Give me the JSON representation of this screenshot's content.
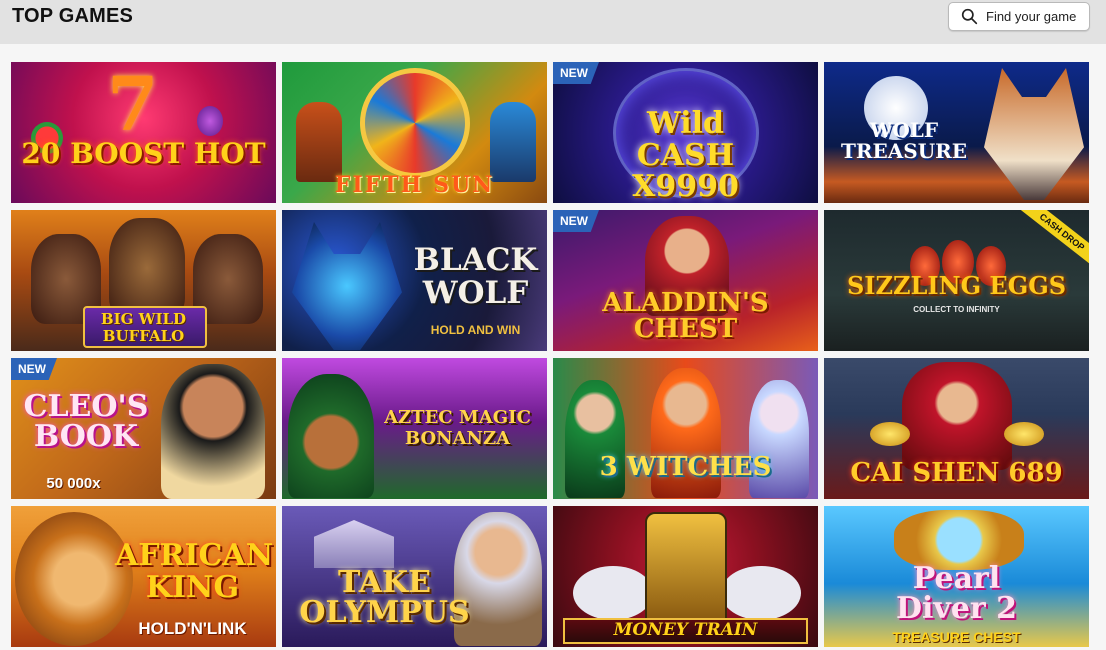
{
  "header": {
    "title": "TOP GAMES",
    "search": {
      "label": "Find your game",
      "icon": "search-icon"
    }
  },
  "badges": {
    "new": "NEW",
    "cash_drop": "CASH DROP"
  },
  "games": [
    {
      "title": "20 BOOST HOT",
      "subtitle": "",
      "badge": "",
      "colors": [
        "#c0114d",
        "#7a0a66"
      ]
    },
    {
      "title": "FIFTH SUN",
      "subtitle": "",
      "badge": "",
      "colors": [
        "#1f8f3c",
        "#d28a10"
      ]
    },
    {
      "title": "Wild CASH X9990",
      "subtitle": "",
      "badge": "NEW",
      "colors": [
        "#1b1b70",
        "#5a2aa8"
      ]
    },
    {
      "title": "WOLF TREASURE",
      "subtitle": "",
      "badge": "",
      "colors": [
        "#0e2a6e",
        "#c65a22"
      ]
    },
    {
      "title": "BIG WILD BUFFALO",
      "subtitle": "",
      "badge": "",
      "colors": [
        "#a84a12",
        "#3a1a1a"
      ]
    },
    {
      "title": "BLACK WOLF",
      "subtitle": "HOLD AND WIN",
      "badge": "",
      "colors": [
        "#10203a",
        "#4a3b7a"
      ]
    },
    {
      "title": "ALADDIN'S CHEST",
      "subtitle": "",
      "badge": "NEW",
      "colors": [
        "#5a1a7a",
        "#b8222a"
      ]
    },
    {
      "title": "SIZZLING EGGS",
      "subtitle": "COLLECT TO INFINITY",
      "badge": "CASH DROP",
      "colors": [
        "#1e2a2e",
        "#3a4a4a"
      ]
    },
    {
      "title": "CLEO'S BOOK",
      "subtitle": "50 000x",
      "badge": "NEW",
      "colors": [
        "#c0681a",
        "#7a3a12"
      ]
    },
    {
      "title": "AZTEC MAGIC BONANZA",
      "subtitle": "",
      "badge": "",
      "colors": [
        "#6a1a8a",
        "#1f6a2a"
      ]
    },
    {
      "title": "3 WITCHES",
      "subtitle": "",
      "badge": "",
      "colors": [
        "#c23a1a",
        "#6a2a8a"
      ]
    },
    {
      "title": "CAI SHEN 689",
      "subtitle": "",
      "badge": "",
      "colors": [
        "#2a3a5a",
        "#8a1a1a"
      ]
    },
    {
      "title": "AFRICAN KING",
      "subtitle": "HOLD'N'LINK",
      "badge": "",
      "colors": [
        "#e0801a",
        "#a83a10"
      ]
    },
    {
      "title": "TAKE OLYMPUS",
      "subtitle": "",
      "badge": "",
      "colors": [
        "#4a3a8a",
        "#8a5ab8"
      ]
    },
    {
      "title": "MONEY TRAIN",
      "subtitle": "",
      "badge": "",
      "colors": [
        "#8a1020",
        "#3a0a10"
      ]
    },
    {
      "title": "Pearl Diver 2",
      "subtitle": "TREASURE CHEST",
      "badge": "",
      "colors": [
        "#1a8ad8",
        "#e8c84a"
      ]
    }
  ]
}
